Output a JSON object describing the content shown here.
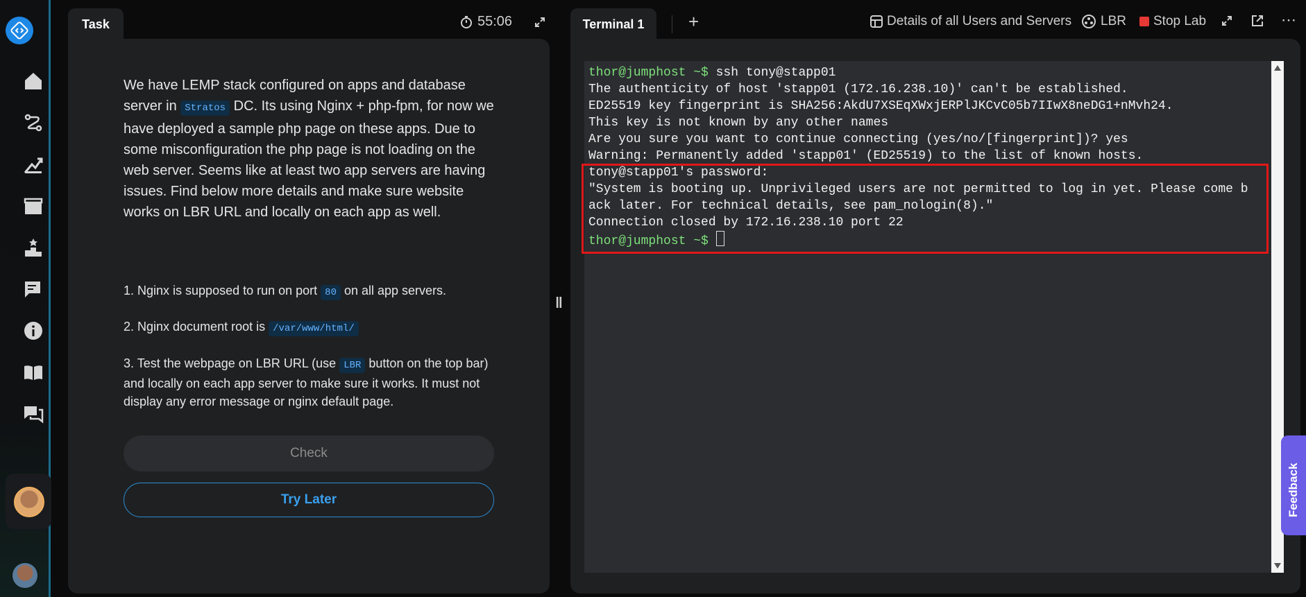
{
  "task": {
    "tab_label": "Task",
    "timer": "55:06",
    "description_before": "We have LEMP stack configured on apps and database server in ",
    "dc_name": "Stratos",
    "description_after": " DC. Its using Nginx + php-fpm, for now we have deployed a sample php page on these apps. Due to some misconfiguration the php page is not loading on the web server. Seems like at least two app servers are having issues. Find below more details and make sure website works on LBR URL and locally on each app as well.",
    "step1_before": "1. Nginx is supposed to run on port ",
    "step1_code": "80",
    "step1_after": " on all app servers.",
    "step2_before": "2. Nginx document root is ",
    "step2_code": "/var/www/html/",
    "step3_before": "3. Test the webpage on LBR URL (use ",
    "step3_code": "LBR",
    "step3_after": " button on the top bar) and locally on each app server to make sure it works. It must not display any error message or nginx default page.",
    "check_label": "Check",
    "try_later_label": "Try Later"
  },
  "terminal": {
    "tab_label": "Terminal 1",
    "details_label": "Details of all Users and Servers",
    "lbr_label": "LBR",
    "stop_lab_label": "Stop Lab",
    "prompt": "thor@jumphost ~$",
    "cmd1": " ssh tony@stapp01",
    "lines": [
      "The authenticity of host 'stapp01 (172.16.238.10)' can't be established.",
      "ED25519 key fingerprint is SHA256:AkdU7XSEqXWxjERPlJKCvC05b7IIwX8neDG1+nMvh24.",
      "This key is not known by any other names",
      "Are you sure you want to continue connecting (yes/no/[fingerprint])? yes",
      "Warning: Permanently added 'stapp01' (ED25519) to the list of known hosts.",
      "tony@stapp01's password:",
      "\"System is booting up. Unprivileged users are not permitted to log in yet. Please come b",
      "ack later. For technical details, see pam_nologin(8).\"",
      "Connection closed by 172.16.238.10 port 22"
    ]
  },
  "feedback_label": "Feedback",
  "colors": {
    "accent": "#2a8fd8",
    "prompt_green": "#7ee07a",
    "highlight_red": "#e01818",
    "feedback_purple": "#6b5de6"
  }
}
